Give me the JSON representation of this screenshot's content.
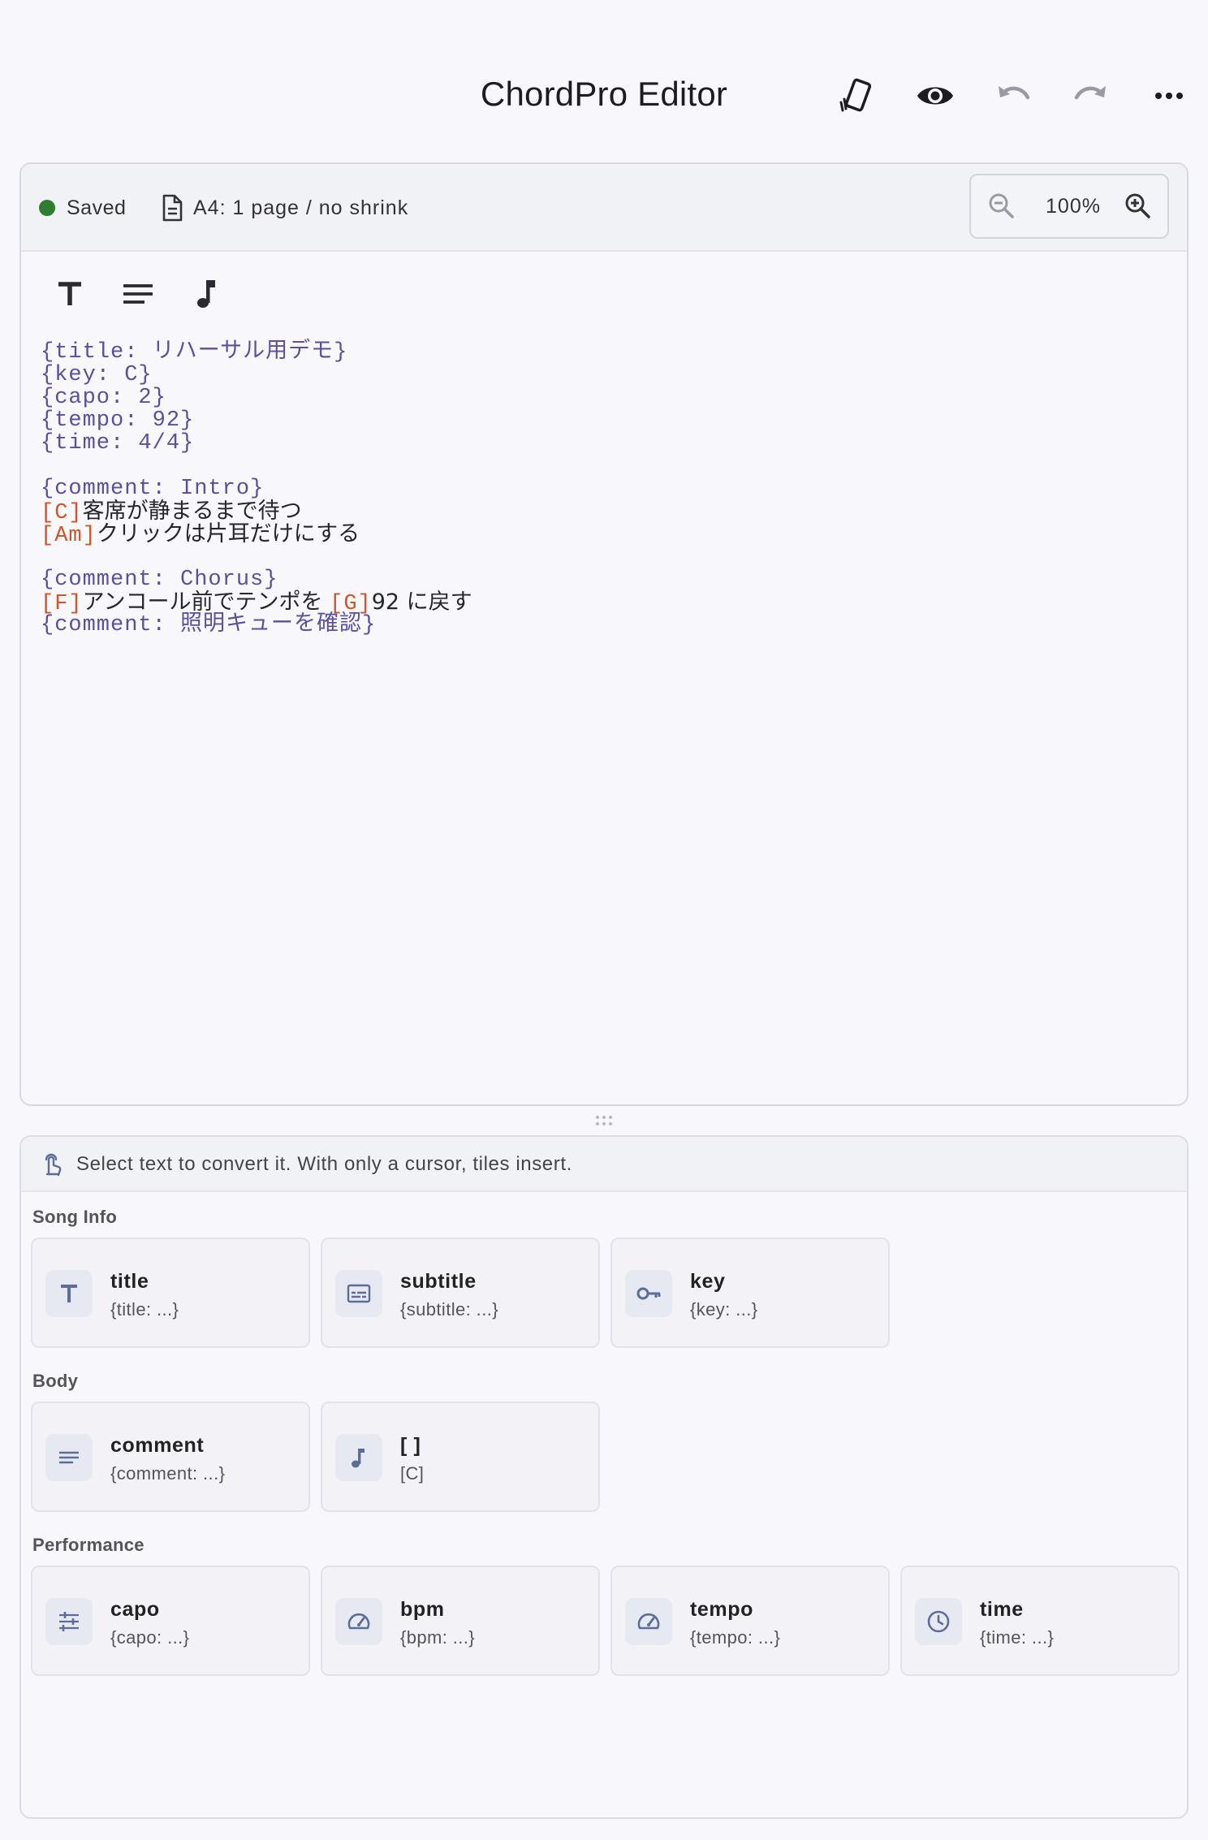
{
  "app": {
    "title": "ChordPro Editor"
  },
  "status": {
    "saved_label": "Saved",
    "page_info": "A4: 1 page / no shrink",
    "zoom": "100%",
    "saved_color": "#2e7d32"
  },
  "editor": {
    "lines": [
      [
        {
          "t": "{title: リハーサル用デモ}",
          "k": "dir"
        }
      ],
      [
        {
          "t": "{key: C}",
          "k": "dir"
        }
      ],
      [
        {
          "t": "{capo: 2}",
          "k": "dir"
        }
      ],
      [
        {
          "t": "{tempo: 92}",
          "k": "dir"
        }
      ],
      [
        {
          "t": "{time: 4/4}",
          "k": "dir"
        }
      ],
      [],
      [
        {
          "t": "{comment: Intro}",
          "k": "dir"
        }
      ],
      [
        {
          "t": "[C]",
          "k": "chord"
        },
        {
          "t": "客席が静まるまで待つ",
          "k": "lyric"
        }
      ],
      [
        {
          "t": "[Am]",
          "k": "chord"
        },
        {
          "t": "クリックは片耳だけにする",
          "k": "lyric"
        }
      ],
      [],
      [
        {
          "t": "{comment: Chorus}",
          "k": "dir"
        }
      ],
      [
        {
          "t": "[F]",
          "k": "chord"
        },
        {
          "t": "アンコール前でテンポを ",
          "k": "lyric"
        },
        {
          "t": "[G]",
          "k": "chord"
        },
        {
          "t": "92 に戻す",
          "k": "lyric"
        }
      ],
      [
        {
          "t": "{comment: 照明キューを確認}",
          "k": "dir"
        }
      ]
    ]
  },
  "hint": "Select text to convert it. With only a cursor, tiles insert.",
  "sections": {
    "song_info": {
      "title": "Song Info",
      "tiles": [
        {
          "name": "title",
          "snippet": "{title: ...}",
          "icon": "text-t-icon"
        },
        {
          "name": "subtitle",
          "snippet": "{subtitle: ...}",
          "icon": "subtitles-icon"
        },
        {
          "name": "key",
          "snippet": "{key: ...}",
          "icon": "key-icon"
        }
      ]
    },
    "body": {
      "title": "Body",
      "tiles": [
        {
          "name": "comment",
          "snippet": "{comment: ...}",
          "icon": "lines-icon"
        },
        {
          "name": "[ ]",
          "snippet": "[C]",
          "icon": "music-note-icon"
        }
      ]
    },
    "performance": {
      "title": "Performance",
      "tiles": [
        {
          "name": "capo",
          "snippet": "{capo: ...}",
          "icon": "tune-icon"
        },
        {
          "name": "bpm",
          "snippet": "{bpm: ...}",
          "icon": "speedometer-icon"
        },
        {
          "name": "tempo",
          "snippet": "{tempo: ...}",
          "icon": "speedometer-icon"
        },
        {
          "name": "time",
          "snippet": "{time: ...}",
          "icon": "clock-icon"
        }
      ]
    }
  },
  "colors": {
    "directive": "#5a4fa0",
    "chord": "#d2542a",
    "icon_accent": "#5b6d99"
  }
}
